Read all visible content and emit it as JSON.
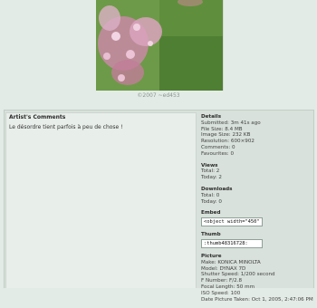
{
  "photo": {
    "copyright": "©2007 ~ed453"
  },
  "comments": {
    "title": "Artist's Comments",
    "text": "Le désordre tient parfois à peu de chose !"
  },
  "details": {
    "title": "Details",
    "submitted": "Submitted: 3m 41s ago",
    "file_size": "File Size: 8.4 MB",
    "image_size": "Image Size: 232 KB",
    "resolution": "Resolution: 600×902",
    "comments": "Comments: 0",
    "favourites": "Favourites: 0"
  },
  "views": {
    "title": "Views",
    "total": "Total: 2",
    "today": "Today: 2"
  },
  "downloads": {
    "title": "Downloads",
    "total": "Total: 0",
    "today": "Today: 0"
  },
  "embed": {
    "title": "Embed",
    "value": "<object width=\"450\" heig"
  },
  "thumb": {
    "title": "Thumb",
    "value": ":thumb48316728:"
  },
  "picture": {
    "title": "Picture",
    "make": "Make: KONICA MINOLTA",
    "model": "Model: DYNAX 7D",
    "shutter": "Shutter Speed: 1/200 second",
    "fnumber": "F Number: F/2.8",
    "focal": "Focal Length: 50 mm",
    "iso": "ISO Speed: 100",
    "taken": "Date Picture Taken: Oct 1, 2005, 2:47:06 PM"
  }
}
